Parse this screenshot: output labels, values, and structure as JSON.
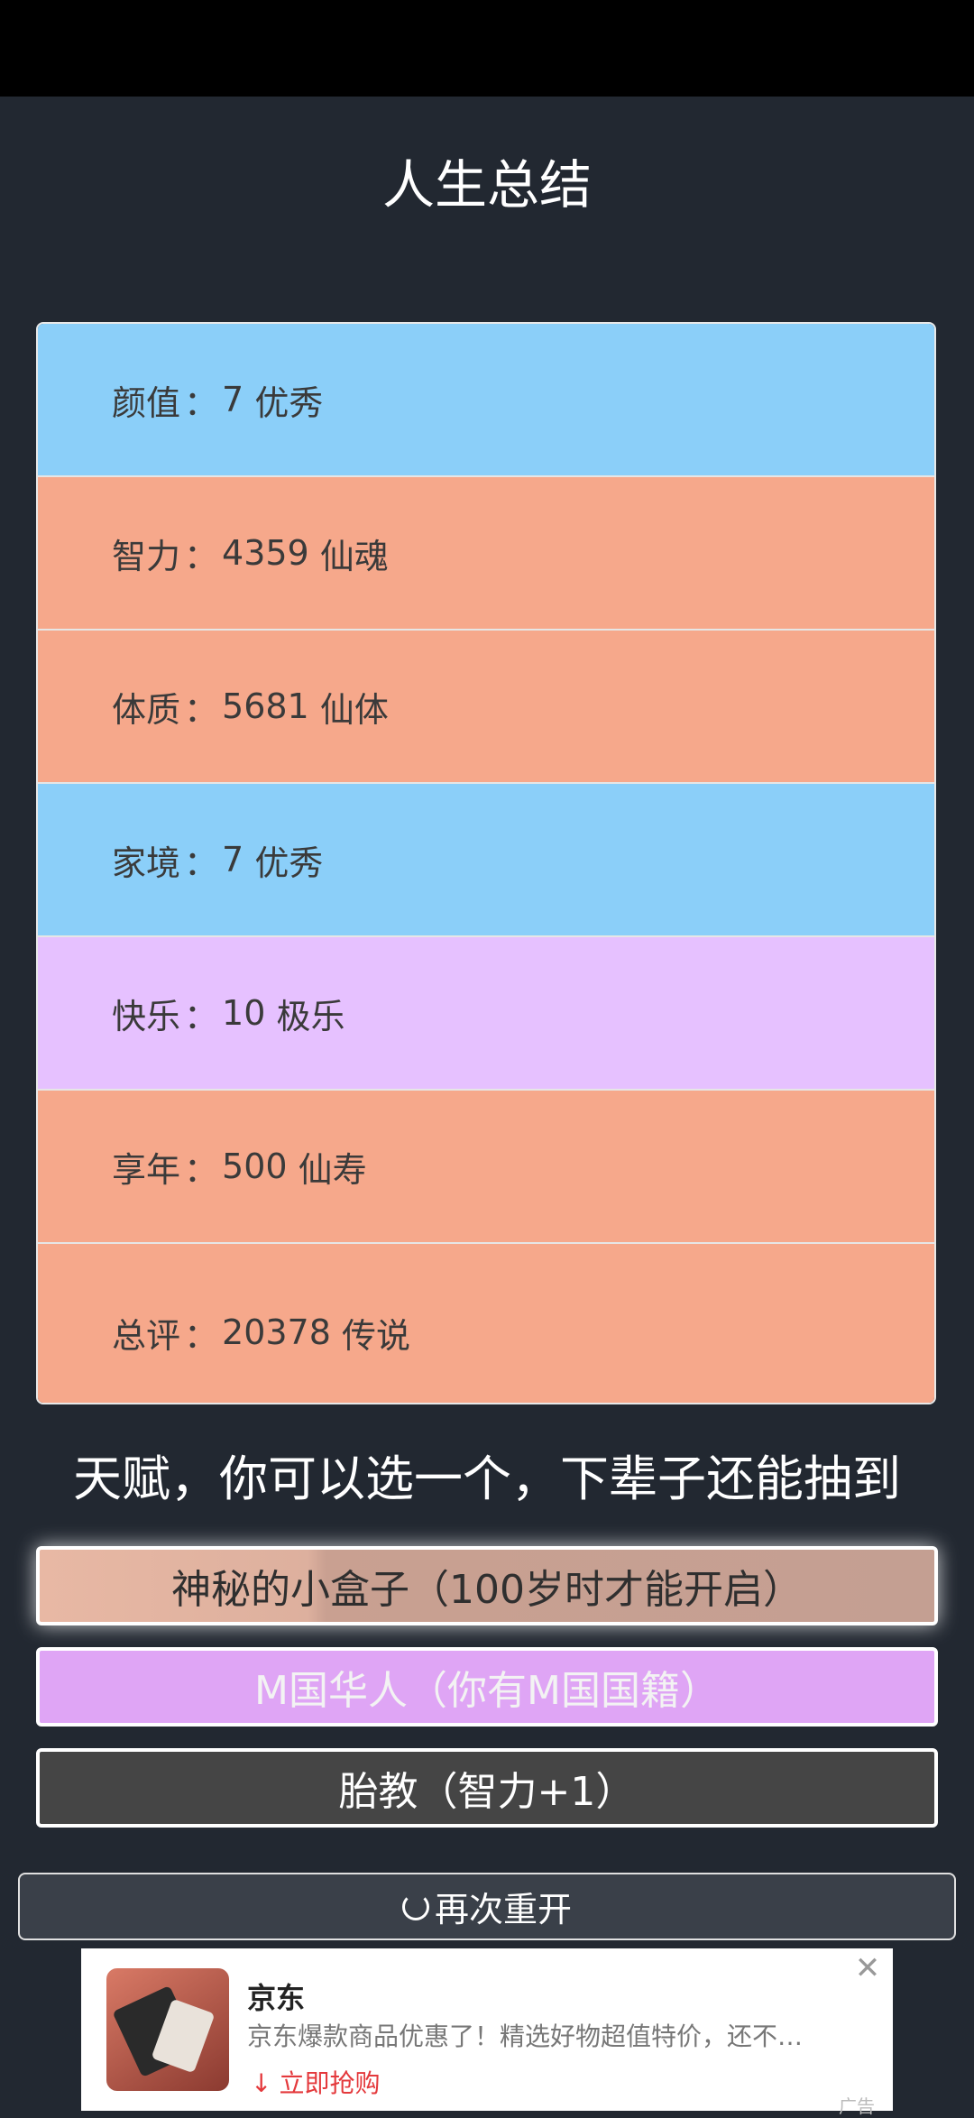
{
  "title": "人生总结",
  "stats": [
    {
      "label": "颜值",
      "value": "7",
      "grade": "优秀",
      "color": "#8bcff9"
    },
    {
      "label": "智力",
      "value": "4359",
      "grade": "仙魂",
      "color": "#f6a88b"
    },
    {
      "label": "体质",
      "value": "5681",
      "grade": "仙体",
      "color": "#f6a88b"
    },
    {
      "label": "家境",
      "value": "7",
      "grade": "优秀",
      "color": "#8bcff9"
    },
    {
      "label": "快乐",
      "value": "10",
      "grade": "极乐",
      "color": "#e6c1ff"
    },
    {
      "label": "享年",
      "value": "500",
      "grade": "仙寿",
      "color": "#f6a88b"
    },
    {
      "label": "总评",
      "value": "20378",
      "grade": "传说",
      "color": "#f6a88b"
    }
  ],
  "separator": "：",
  "talent_heading": "天赋，你可以选一个，下辈子还能抽到",
  "talents": [
    {
      "label": "神秘的小盒子（100岁时才能开启）"
    },
    {
      "label": "M国华人（你有M国国籍）"
    },
    {
      "label": "胎教（智力+1）"
    }
  ],
  "restart_label": "再次重开",
  "ad": {
    "brand": "京东",
    "description": "京东爆款商品优惠了！精选好物超值特价，还不…",
    "cta": "立即抢购",
    "tag": "广告"
  }
}
